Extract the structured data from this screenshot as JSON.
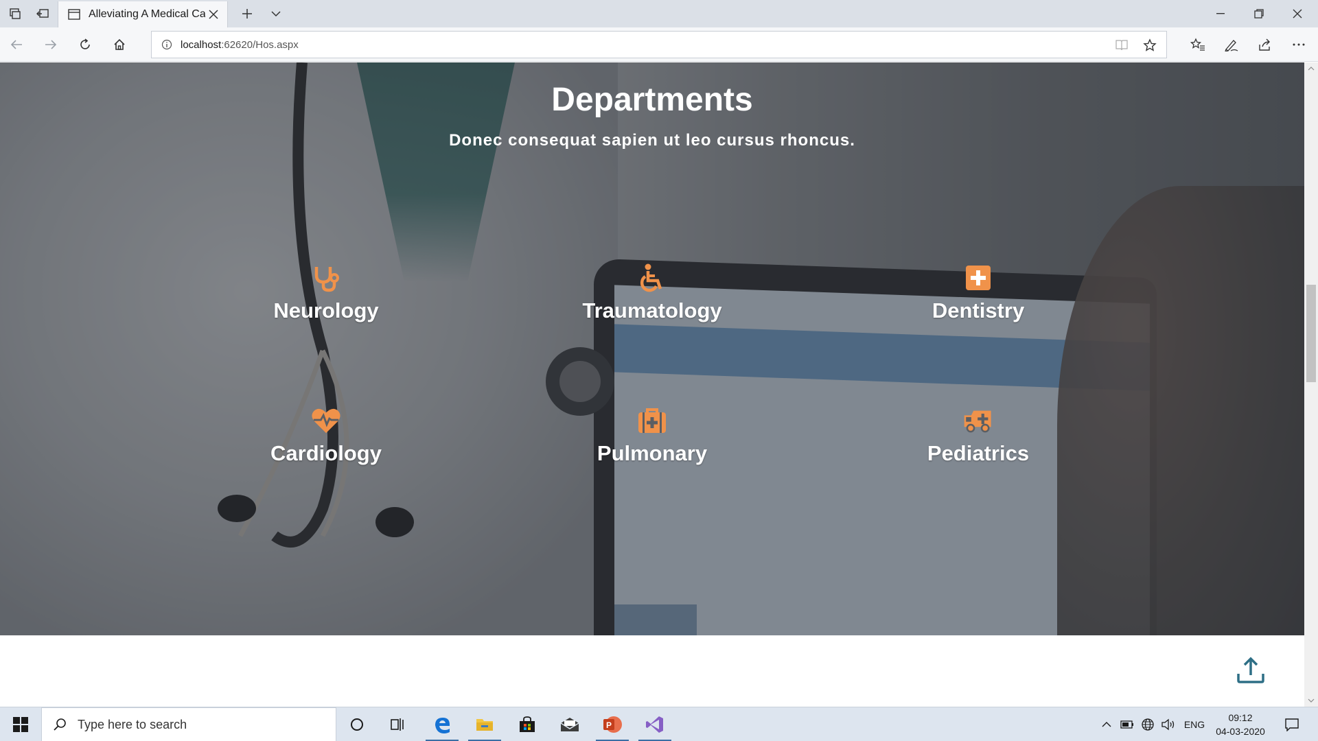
{
  "browser": {
    "tab_title": "Alleviating A Medical Ca",
    "url_host": "localhost",
    "url_path": ":62620/Hos.aspx"
  },
  "page": {
    "title": "Departments",
    "subtitle": "Donec consequat sapien ut leo cursus rhoncus.",
    "departments": [
      {
        "name": "Neurology",
        "icon": "stethoscope-icon"
      },
      {
        "name": "Traumatology",
        "icon": "wheelchair-icon"
      },
      {
        "name": "Dentistry",
        "icon": "medical-plus-icon"
      },
      {
        "name": "Cardiology",
        "icon": "heartbeat-icon"
      },
      {
        "name": "Pulmonary",
        "icon": "medkit-icon"
      },
      {
        "name": "Pediatrics",
        "icon": "ambulance-icon"
      }
    ],
    "accent_color": "#f0924a",
    "back_to_top_color": "#2e6f86"
  },
  "taskbar": {
    "search_placeholder": "Type here to search",
    "language": "ENG",
    "time": "09:12",
    "date": "04-03-2020"
  }
}
